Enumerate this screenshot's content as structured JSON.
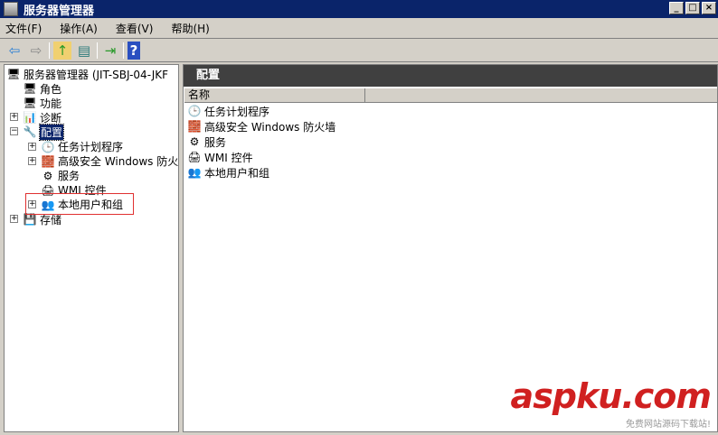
{
  "window": {
    "title": "服务器管理器",
    "min": "_",
    "max": "□",
    "close": "×"
  },
  "menu": [
    "文件(F)",
    "操作(A)",
    "查看(V)",
    "帮助(H)"
  ],
  "toolbar": {
    "back": "⇦",
    "forward": "⇨",
    "up": "↑",
    "showhide": "▤",
    "export": "⇥",
    "help": "?"
  },
  "tree": [
    {
      "label": "服务器管理器 (JIT-SBJ-04-JKF",
      "icon": "🖥",
      "expander": ""
    },
    {
      "label": "角色",
      "icon": "🖥",
      "expander": ""
    },
    {
      "label": "功能",
      "icon": "🖥",
      "expander": ""
    },
    {
      "label": "诊断",
      "icon": "📊",
      "expander": "+"
    },
    {
      "label": "配置",
      "icon": "🔧",
      "expander": "−"
    },
    {
      "label": "任务计划程序",
      "icon": "🕒",
      "expander": "+"
    },
    {
      "label": "高级安全 Windows 防火墙",
      "icon": "🧱",
      "expander": "+"
    },
    {
      "label": "服务",
      "icon": "⚙",
      "expander": ""
    },
    {
      "label": "WMI 控件",
      "icon": "🖨",
      "expander": ""
    },
    {
      "label": "本地用户和组",
      "icon": "👥",
      "expander": "+"
    },
    {
      "label": "存储",
      "icon": "💾",
      "expander": "+"
    }
  ],
  "right": {
    "title": "配置",
    "column": "名称",
    "items": [
      {
        "label": "任务计划程序",
        "icon": "🕒"
      },
      {
        "label": "高级安全 Windows 防火墙",
        "icon": "🧱"
      },
      {
        "label": "服务",
        "icon": "⚙"
      },
      {
        "label": "WMI 控件",
        "icon": "🖨"
      },
      {
        "label": "本地用户和组",
        "icon": "👥"
      }
    ]
  },
  "watermark": {
    "brand": "aspku.com",
    "tagline": "免费网站源码下载站!"
  }
}
